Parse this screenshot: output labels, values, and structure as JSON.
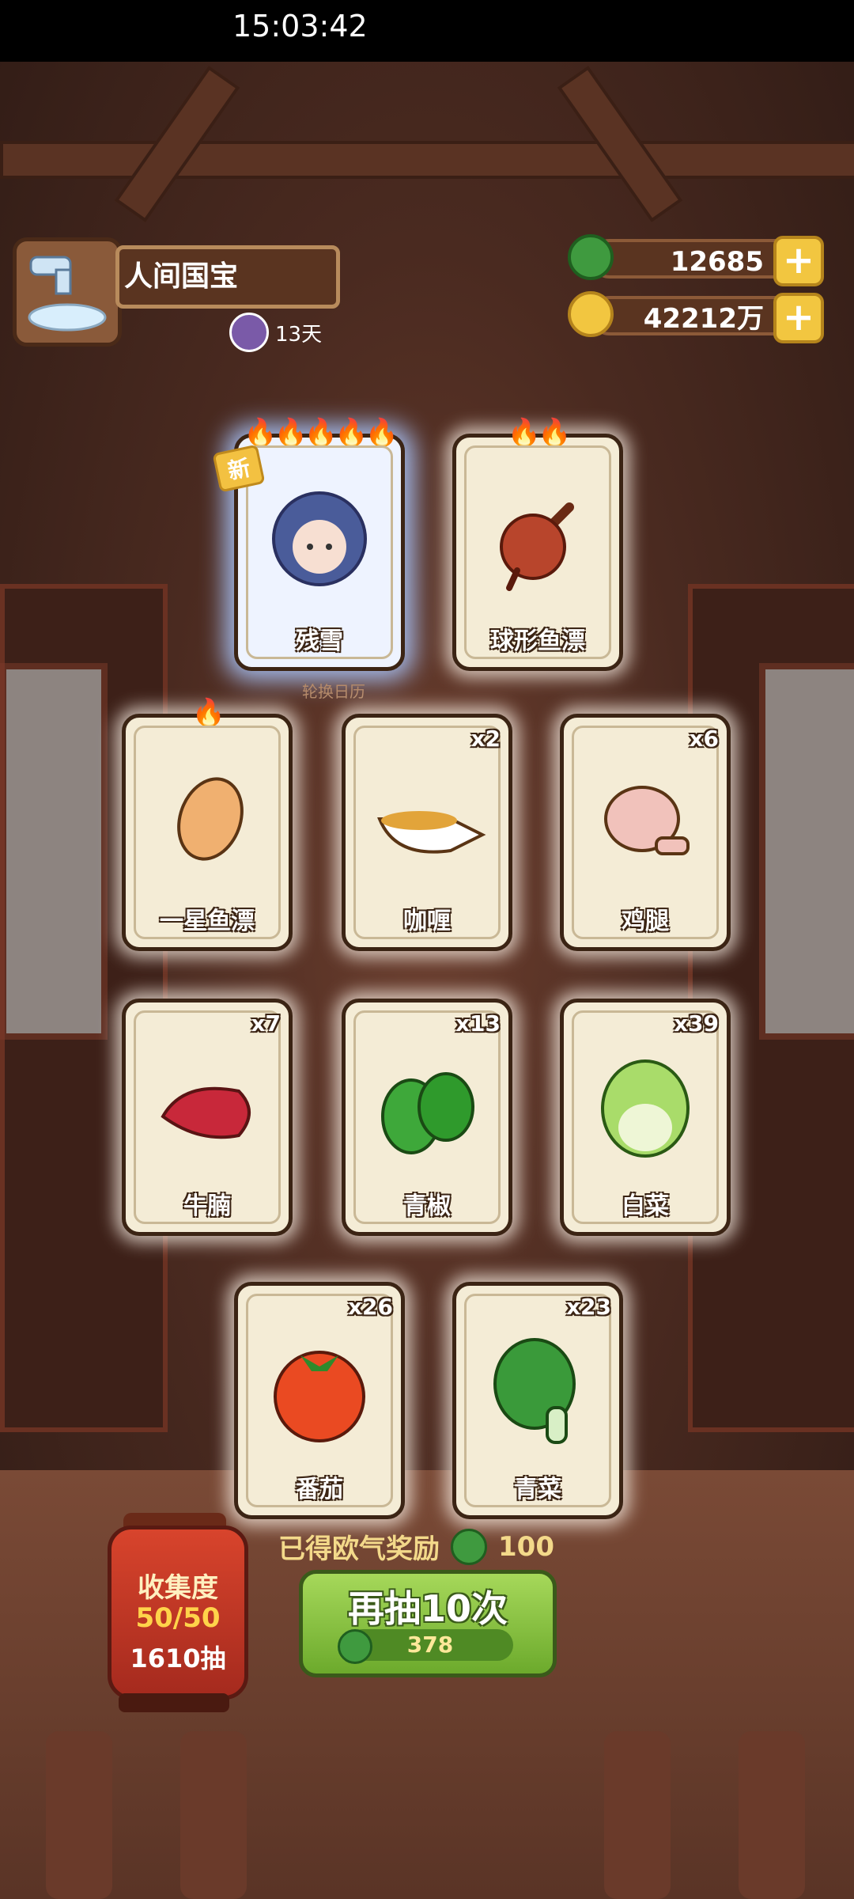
{
  "status_bar": {
    "time": "15:03:42"
  },
  "header": {
    "title": "人间国宝",
    "days": "13天"
  },
  "currency": {
    "jade": {
      "value": "12685",
      "icon": "jade-coin-icon"
    },
    "gold": {
      "value": "42212万",
      "icon": "gold-coin-icon"
    }
  },
  "cards": [
    {
      "name": "残雪",
      "flames": 5,
      "new_badge": "新",
      "count": "",
      "rarity": "legendary"
    },
    {
      "name": "球形鱼漂",
      "flames": 2,
      "count": ""
    },
    {
      "name": "一星鱼漂",
      "flames": 1,
      "count": ""
    },
    {
      "name": "咖喱",
      "flames": 0,
      "count": "x2"
    },
    {
      "name": "鸡腿",
      "flames": 0,
      "count": "x6"
    },
    {
      "name": "牛腩",
      "flames": 0,
      "count": "x7"
    },
    {
      "name": "青椒",
      "flames": 0,
      "count": "x13"
    },
    {
      "name": "白菜",
      "flames": 0,
      "count": "x39"
    },
    {
      "name": "番茄",
      "flames": 0,
      "count": "x26"
    },
    {
      "name": "青菜",
      "flames": 0,
      "count": "x23"
    }
  ],
  "calendar_label": "轮换日历",
  "bonus": {
    "text": "已得欧气奖励",
    "amount": "100"
  },
  "draw_button": {
    "label": "再抽10次",
    "cost": "378"
  },
  "collection": {
    "title": "收集度",
    "progress": "50/50",
    "draws": "1610抽"
  }
}
